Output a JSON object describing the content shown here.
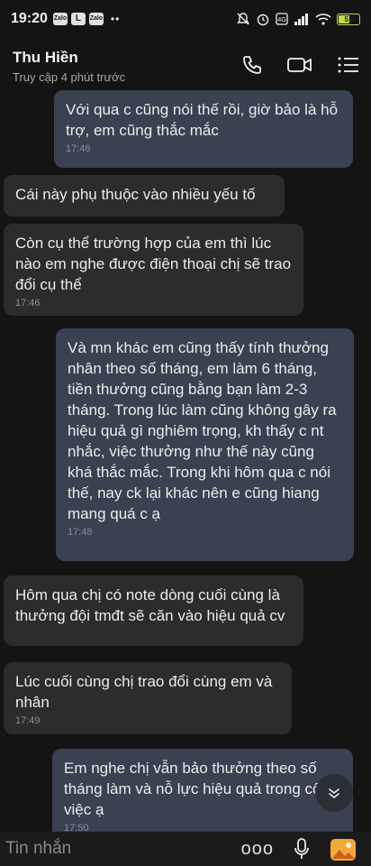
{
  "status": {
    "time": "19:20",
    "app_badges": [
      "Zalo",
      "L",
      "Zalo"
    ],
    "more_dots": "••",
    "battery_level": "51"
  },
  "header": {
    "contact_name": "Thu Hiền",
    "last_seen": "Truy cập 4 phút trước",
    "icons": [
      "phone-icon",
      "video-camera-icon",
      "menu-list-icon"
    ]
  },
  "messages": [
    {
      "dir": "out",
      "text": "Với qua c cũng nói thế rồi, giờ bảo là hỗ trợ, em cũng thắc mắc",
      "time": "17:46"
    },
    {
      "dir": "in",
      "text": "Cái này phụ thuộc vào nhiều yếu tố",
      "time": ""
    },
    {
      "dir": "in",
      "text": "Còn cụ thể trường hợp của em thì lúc nào em nghe được điện thoại chị sẽ trao đổi cụ thể",
      "time": "17:46"
    },
    {
      "dir": "out",
      "text": "Và mn khác em cũng thấy tính thưởng  nhân theo số tháng, em làm 6 tháng, tiền thưởng cũng bằng bạn làm 2-3 tháng. Trong lúc làm cũng không gây ra hiệu quả gì nghiêm trọng, kh thấy c nt nhắc, việc thưởng như thế này cũng khá thắc mắc. Trong khi hôm qua c nói thế, nay ck lại khác nên e cũng hiang mang quá c ạ",
      "time": "17:48"
    },
    {
      "dir": "in",
      "text": "Hôm qua chị có note dòng cuối cùng là thưởng đội tmđt sẽ căn vào hiệu quả cv",
      "time": ""
    },
    {
      "dir": "in",
      "text": "Lúc cuối cùng chị trao đổi cùng em và nhân",
      "time": "17:49"
    },
    {
      "dir": "out",
      "text": "Em nghe chị vẫn bảo thưởng theo số tháng làm và nỗ lực hiệu quả trong công việc ạ",
      "time": "17:50"
    }
  ],
  "input": {
    "placeholder": "Tin nhắn",
    "more_label": "ooo"
  }
}
